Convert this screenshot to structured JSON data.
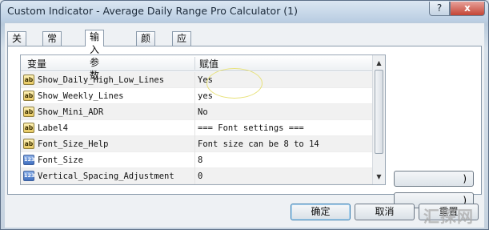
{
  "window": {
    "title": "Custom Indicator - Average Daily Range Pro Calculator (1)",
    "help_label": "?",
    "close_label": "x"
  },
  "tabs": [
    "关于",
    "常用",
    "输入参数",
    "颜色",
    "应用范围"
  ],
  "active_tab": "输入参数",
  "grid": {
    "headers": {
      "variable": "变量",
      "value": "赋值"
    },
    "rows": [
      {
        "type": "ab",
        "name": "Show_Daily_High_Low_Lines",
        "value": "Yes"
      },
      {
        "type": "ab",
        "name": "Show_Weekly_Lines",
        "value": "yes"
      },
      {
        "type": "ab",
        "name": "Show_Mini_ADR",
        "value": "No"
      },
      {
        "type": "ab",
        "name": "Label4",
        "value": "=== Font settings ==="
      },
      {
        "type": "ab",
        "name": "Font_Size_Help",
        "value": "Font size can be 8 to 14"
      },
      {
        "type": "123",
        "name": "Font_Size",
        "value": "8"
      },
      {
        "type": "123",
        "name": "Vertical_Spacing_Adjustment",
        "value": "0"
      }
    ]
  },
  "side_buttons": [
    ")",
    ")"
  ],
  "buttons": {
    "ok": "确定",
    "cancel": "取消",
    "reset": "重置"
  },
  "watermark": "汇探网"
}
